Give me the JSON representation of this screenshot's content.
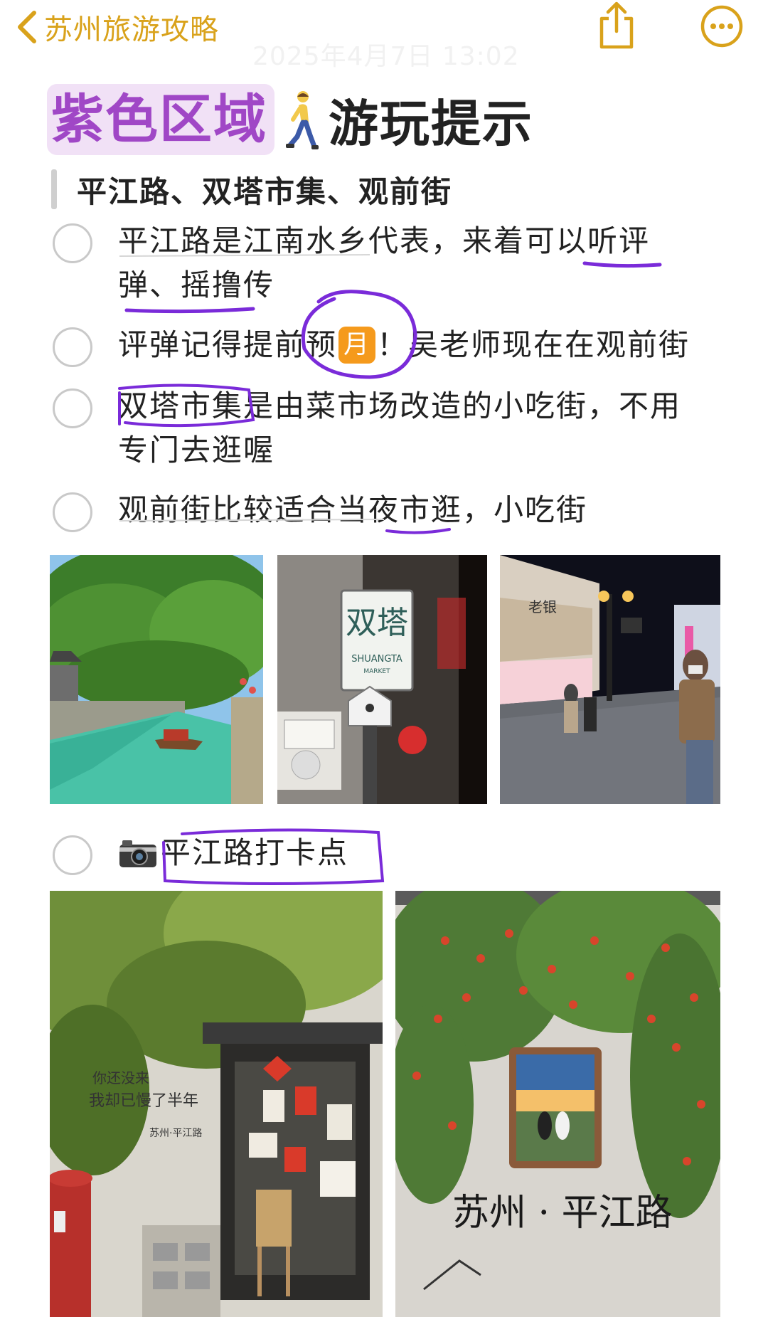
{
  "nav": {
    "back_label": "苏州旅游攻略",
    "date_text": "2025年4月7日 13:02",
    "accent_color": "#d9a21b"
  },
  "title": {
    "highlight_text": "紫色区域",
    "rest_text": "游玩提示",
    "highlight_color": "#a047c6",
    "icon": "person-walking-icon"
  },
  "section": {
    "heading": "平江路、双塔市集、观前街"
  },
  "checklist": [
    {
      "line1": "平江路是江南水乡代表，来着可以听评",
      "line2": "弹、摇撸传",
      "checked": false
    },
    {
      "text_before": "评弹记得提前预",
      "month_emoji": "月",
      "text_after": "！吴老师现在在观前街",
      "checked": false
    },
    {
      "line1": "双塔市集是由菜市场改造的小吃街，不用",
      "line2": "专门去逛喔",
      "checked": false
    },
    {
      "line1": "观前街比较适合当夜市逛，小吃街",
      "checked": false
    },
    {
      "camera_icon": "camera-icon",
      "text": "平江路打卡点",
      "checked": false
    }
  ],
  "photos": {
    "shuangta_sign_main": "双塔",
    "shuangta_sign_sub": "SHUANGTA",
    "shuangta_sign_sub2": "MARKET",
    "guanqian_store_sign": "老银",
    "wall_text_1": "你还没来",
    "wall_text_2": "我却已慢了半年",
    "wall_text_3": "苏州·平江路",
    "wall_calligraphy": "苏州 · 平江路"
  },
  "colors": {
    "annotation_purple": "#7a2bd9",
    "month_badge": "#f59a1c"
  }
}
